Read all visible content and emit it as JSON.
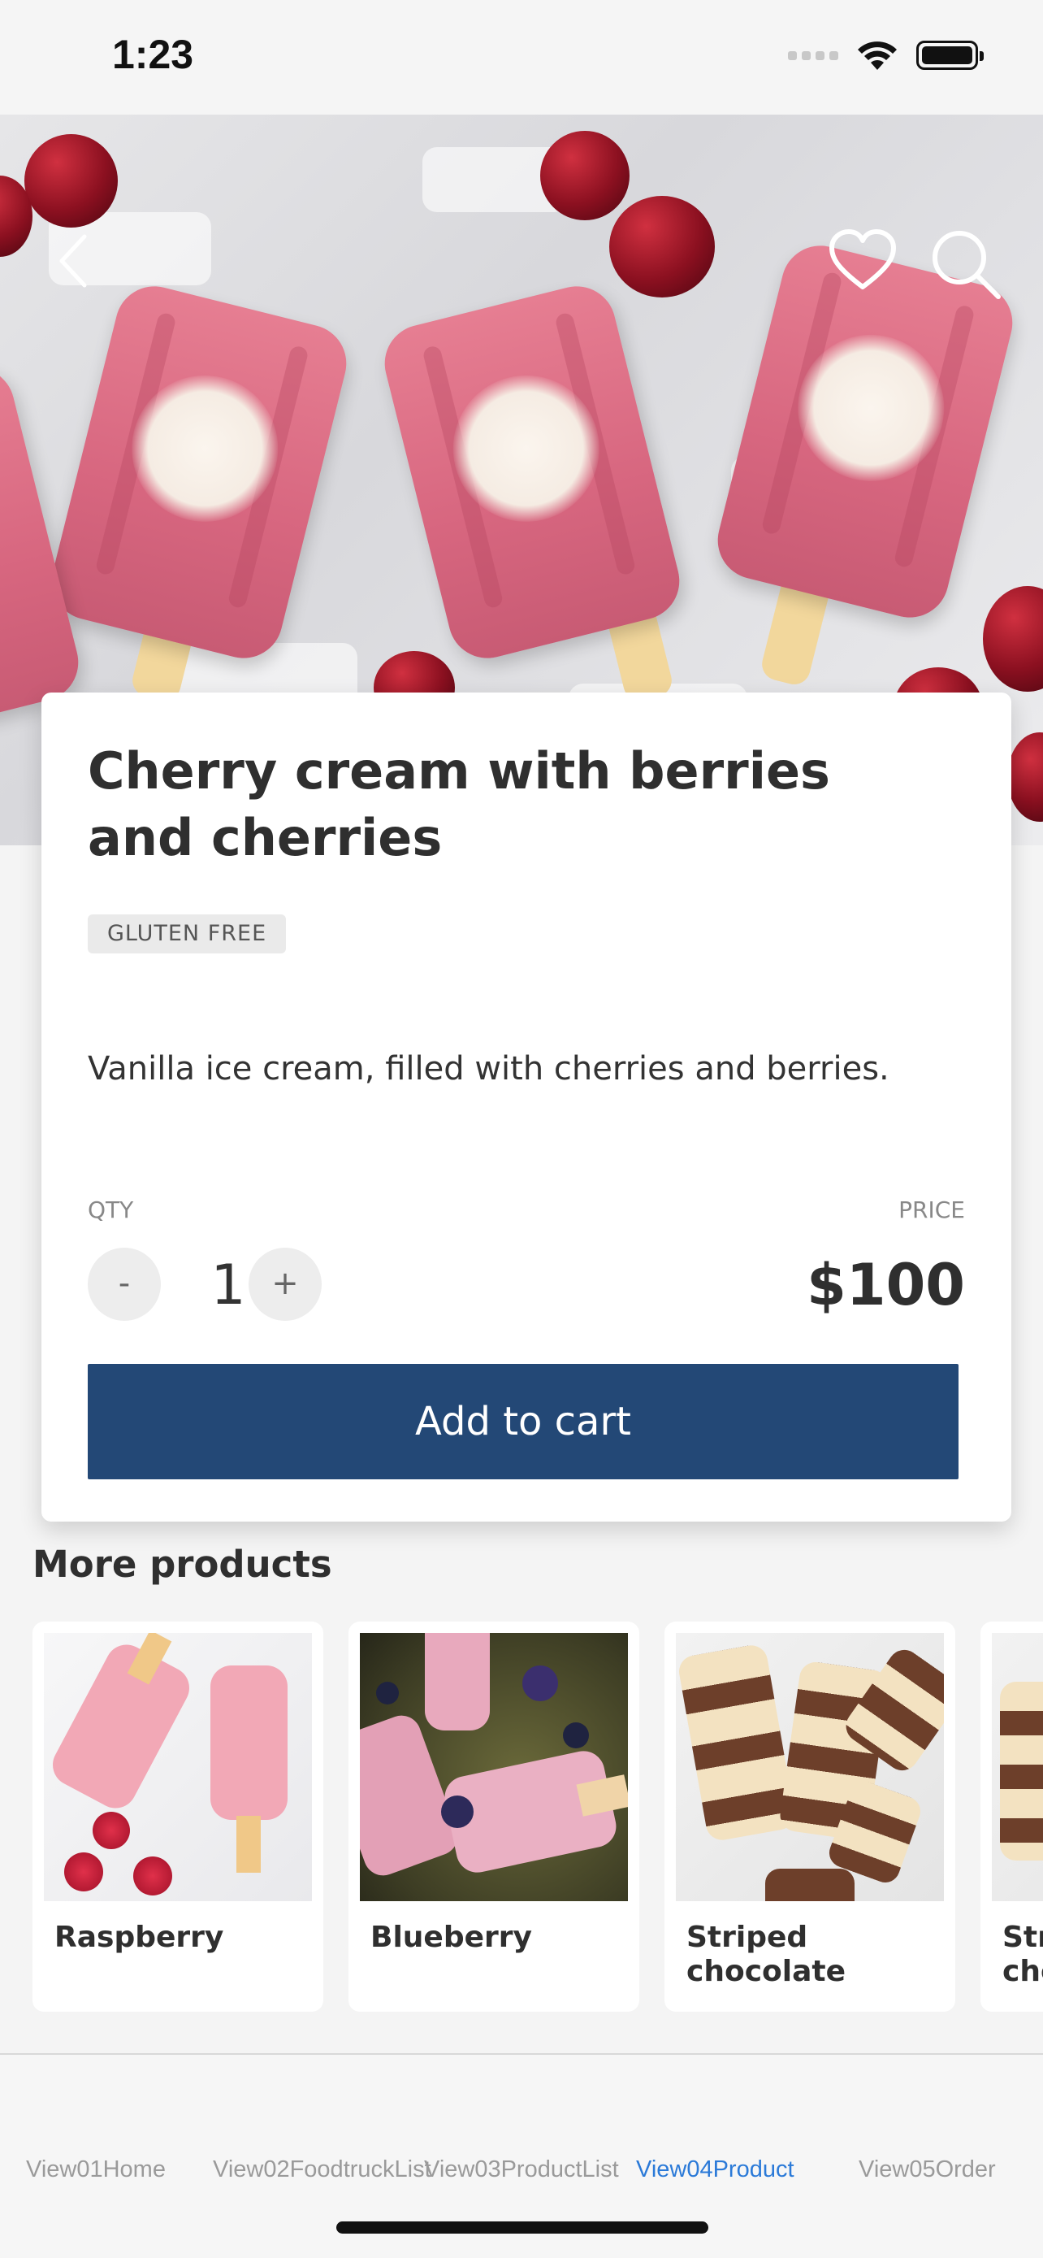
{
  "status_bar": {
    "time": "1:23"
  },
  "header": {
    "back_icon": "chevron-left-icon",
    "favorite_icon": "heart-icon",
    "search_icon": "search-icon"
  },
  "product": {
    "title": "Cherry cream with berries and cherries",
    "badge": "GLUTEN FREE",
    "description": "Vanilla ice cream, filled with cherries and berries.",
    "qty_label": "QTY",
    "price_label": "PRICE",
    "quantity": "1",
    "decrement_label": "-",
    "increment_label": "+",
    "price": "$100",
    "add_to_cart_label": "Add to cart",
    "accent_color": "#234876"
  },
  "more_products": {
    "title": "More products",
    "items": [
      {
        "name": "Raspberry"
      },
      {
        "name": "Blueberry"
      },
      {
        "name": "Striped chocolate"
      },
      {
        "name": "Striped chocolate"
      }
    ]
  },
  "tabbar": {
    "tabs": [
      {
        "label": "View01Home"
      },
      {
        "label": "View02FoodtruckList"
      },
      {
        "label": "View03ProductList"
      },
      {
        "label": "View04Product"
      },
      {
        "label": "View05Order"
      }
    ],
    "active_color": "#2b7ad8"
  }
}
